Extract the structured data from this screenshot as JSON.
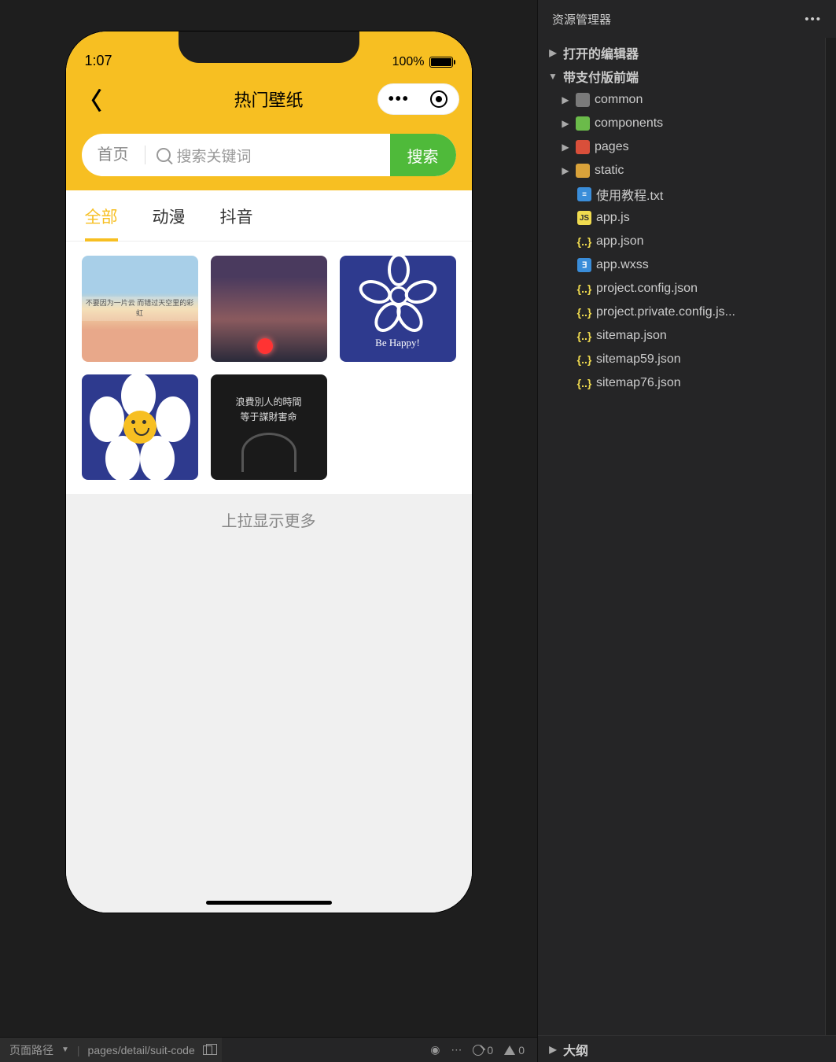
{
  "preview": {
    "time": "1:07",
    "battery": "100%",
    "title": "热门壁纸",
    "search_home": "首页",
    "search_placeholder": "搜索关键词",
    "search_btn": "搜索",
    "tabs": [
      "全部",
      "动漫",
      "抖音"
    ],
    "active_tab": 0,
    "thumbs": {
      "sky_txt": "不要因为一片云\n而错过天空里的彩虹",
      "flower1_cap": "Be Happy!",
      "dark_line1": "浪費別人的時間",
      "dark_line2": "等于謀財害命"
    },
    "load_more": "上拉显示更多"
  },
  "explorer": {
    "title": "资源管理器",
    "sections": {
      "open_editors": "打开的编辑器",
      "project": "带支付版前端",
      "outline": "大纲"
    },
    "folders": [
      {
        "name": "common",
        "icon": "folder-gray"
      },
      {
        "name": "components",
        "icon": "folder-green"
      },
      {
        "name": "pages",
        "icon": "folder-red"
      },
      {
        "name": "static",
        "icon": "folder-yellow"
      }
    ],
    "files": [
      {
        "name": "使用教程.txt",
        "icon": "file-txt"
      },
      {
        "name": "app.js",
        "icon": "file-js",
        "badge": "JS"
      },
      {
        "name": "app.json",
        "icon": "file-json",
        "badge": "{..}"
      },
      {
        "name": "app.wxss",
        "icon": "file-wxss"
      },
      {
        "name": "project.config.json",
        "icon": "file-json",
        "badge": "{..}"
      },
      {
        "name": "project.private.config.js...",
        "icon": "file-json",
        "badge": "{..}"
      },
      {
        "name": "sitemap.json",
        "icon": "file-json",
        "badge": "{..}"
      },
      {
        "name": "sitemap59.json",
        "icon": "file-json",
        "badge": "{..}"
      },
      {
        "name": "sitemap76.json",
        "icon": "file-json",
        "badge": "{..}"
      }
    ]
  },
  "bottom": {
    "path_label": "页面路径",
    "path_value": "pages/detail/suit-code",
    "errors": "0",
    "warnings": "0"
  }
}
